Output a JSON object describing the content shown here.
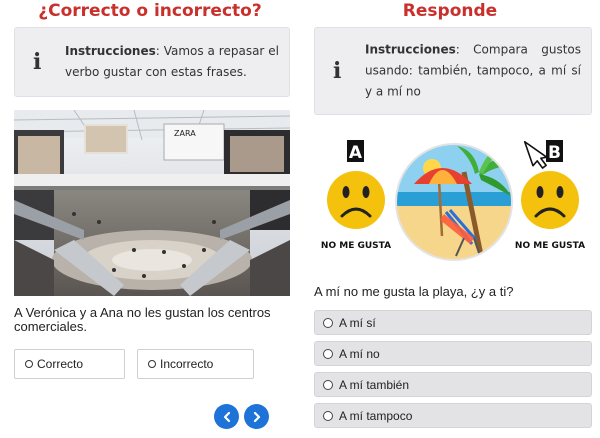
{
  "left": {
    "title": "¿Correcto o incorrecto?",
    "instructions_label": "Instrucciones",
    "instructions_text": ": Vamos a repasar el verbo gustar con estas frases.",
    "statement": "A Verónica y a Ana no les gustan los centros comerciales.",
    "options": [
      "Correcto",
      "Incorrecto"
    ],
    "photo_sign": "ZARA"
  },
  "right": {
    "title": "Responde",
    "instructions_label": "Instrucciones",
    "instructions_text": ": Compara gustos usando: también, tampoco, a mí sí y a mí no",
    "person_a_letter": "A",
    "person_b_letter": "B",
    "person_a_caption": "NO ME GUSTA",
    "person_b_caption": "NO ME GUSTA",
    "question": "A mí no me gusta la playa, ¿y a ti?",
    "options": [
      "A mí sí",
      "A mí no",
      "A mí también",
      "A mí tampoco"
    ]
  },
  "colors": {
    "title_red": "#c9302c",
    "nav_blue": "#1e73d8",
    "emoji_yellow": "#f4c20d"
  },
  "icons": [
    "info-icon",
    "chevron-left-icon",
    "chevron-right-icon",
    "pointer-arrow-icon"
  ]
}
